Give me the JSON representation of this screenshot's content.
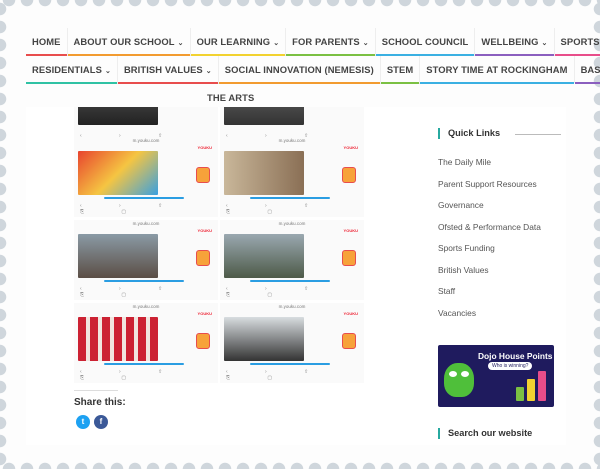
{
  "nav": {
    "row1": [
      {
        "label": "HOME",
        "caret": false
      },
      {
        "label": "ABOUT OUR SCHOOL",
        "caret": true
      },
      {
        "label": "OUR LEARNING",
        "caret": true
      },
      {
        "label": "FOR PARENTS",
        "caret": true
      },
      {
        "label": "SCHOOL COUNCIL",
        "caret": false
      },
      {
        "label": "WELLBEING",
        "caret": true
      },
      {
        "label": "SPORTS",
        "caret": false
      }
    ],
    "row2": [
      {
        "label": "RESIDENTIALS",
        "caret": true
      },
      {
        "label": "BRITISH VALUES",
        "caret": true
      },
      {
        "label": "SOCIAL INNOVATION (NEMESIS)",
        "caret": false
      },
      {
        "label": "STEM",
        "caret": false
      },
      {
        "label": "STORY TIME AT ROCKINGHAM",
        "caret": false
      },
      {
        "label": "BASC",
        "caret": false
      }
    ],
    "row3": [
      {
        "label": "THE ARTS",
        "caret": false
      }
    ],
    "caret_glyph": "⌄"
  },
  "video_grid": {
    "url_text": "m.youku.com",
    "done_text": "Done",
    "brand": "YOUKU"
  },
  "share": {
    "label": "Share this:",
    "twitter_icon": "twitter-icon",
    "facebook_icon": "facebook-icon",
    "twitter_color": "#1da1f2",
    "facebook_color": "#3b5998"
  },
  "sidebar": {
    "quick_links_title": "Quick Links",
    "links": [
      "The Daily Mile",
      "Parent Support Resources",
      "Governance",
      "Ofsted & Performance Data",
      "Sports Funding",
      "British Values",
      "Staff",
      "Vacancies"
    ],
    "dojo_title": "Dojo House Points",
    "dojo_subtitle": "Who is winning?",
    "search_title": "Search our website"
  },
  "colors": {
    "accent": "#27a9a0",
    "dojo_bg": "#1f1b5e",
    "nav_underlines": [
      "#e84d4d",
      "#f29b30",
      "#f2d230",
      "#7bc043",
      "#3ab0e2",
      "#8b5fbf",
      "#e84d8a",
      "#30c2a4"
    ]
  }
}
